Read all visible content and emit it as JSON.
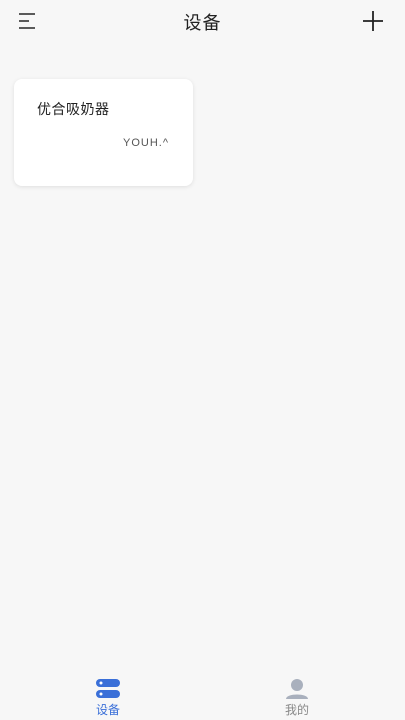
{
  "header": {
    "title": "设备",
    "menu_icon": "menu-icon",
    "add_icon": "plus-icon"
  },
  "devices": [
    {
      "name": "优合吸奶器",
      "brand_logo": "YOUH.^"
    }
  ],
  "tabbar": {
    "tabs": [
      {
        "label": "设备",
        "icon": "device-stack-icon",
        "active": true
      },
      {
        "label": "我的",
        "icon": "person-icon",
        "active": false
      }
    ]
  },
  "colors": {
    "background": "#f7f7f7",
    "card": "#ffffff",
    "accent": "#3a6fd8",
    "inactive": "#888888"
  }
}
